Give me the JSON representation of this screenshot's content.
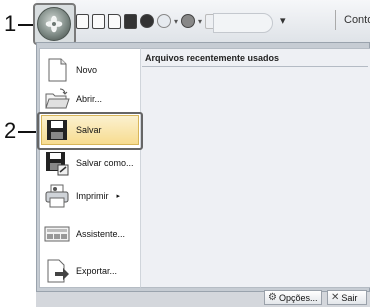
{
  "callouts": {
    "one": "1",
    "two": "2"
  },
  "qat": {
    "dropdown_glyph": "▾",
    "tab_label": "Contor"
  },
  "menu": {
    "recent_title": "Arquivos recentemente usados",
    "items": [
      {
        "label": "Novo",
        "icon": "new-document-icon"
      },
      {
        "label": "Abrir...",
        "icon": "open-folder-icon"
      },
      {
        "label": "Salvar",
        "icon": "save-icon"
      },
      {
        "label": "Salvar como...",
        "icon": "save-as-icon"
      },
      {
        "label": "Imprimir",
        "icon": "printer-icon",
        "submenu_glyph": "▸"
      },
      {
        "label": "Assistente...",
        "icon": "wizard-icon"
      },
      {
        "label": "Exportar...",
        "icon": "export-icon"
      }
    ]
  },
  "footer": {
    "options_label": "Opções...",
    "exit_label": "Sair"
  },
  "colors": {
    "highlight": "#f7dc90",
    "panel": "#eef0f4"
  }
}
